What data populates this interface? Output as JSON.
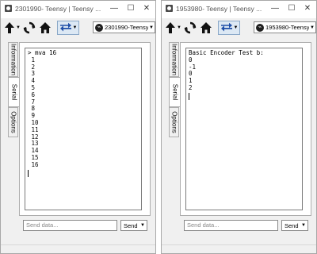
{
  "windows": [
    {
      "title": "2301990- Teensy | Teensy ...",
      "port": "2301990-Teensy",
      "port_badge": "⌁",
      "tabs": [
        "Information",
        "Serial",
        "Options"
      ],
      "output": [
        "> mva 16",
        "1",
        "2",
        "3",
        "4",
        "5",
        "6",
        "7",
        "8",
        "9",
        "10",
        "11",
        "12",
        "13",
        "14",
        "15",
        "16"
      ],
      "send_placeholder": "Send data...",
      "send_label": "Send"
    },
    {
      "title": "1953980- Teensy | Teensy ...",
      "port": "1953980-Teensy",
      "port_badge": "⌁",
      "tabs": [
        "Information",
        "Serial",
        "Options"
      ],
      "output": [
        "Basic Encoder Test b:",
        "0",
        "-1",
        "0",
        "1",
        "2"
      ],
      "send_placeholder": "Send data...",
      "send_label": "Send"
    }
  ],
  "titlebar_buttons": {
    "minimize": "—",
    "maximize": "☐",
    "close": "✕"
  },
  "icons": {
    "upload": "upload-arrow-icon",
    "sync": "sync-icon",
    "home": "home-icon",
    "ports": "swap-arrows-icon",
    "dropdown": "chevron-down-icon"
  },
  "colors": {
    "accent": "#1f4fa8",
    "port_badge": "#1f1f1f"
  }
}
